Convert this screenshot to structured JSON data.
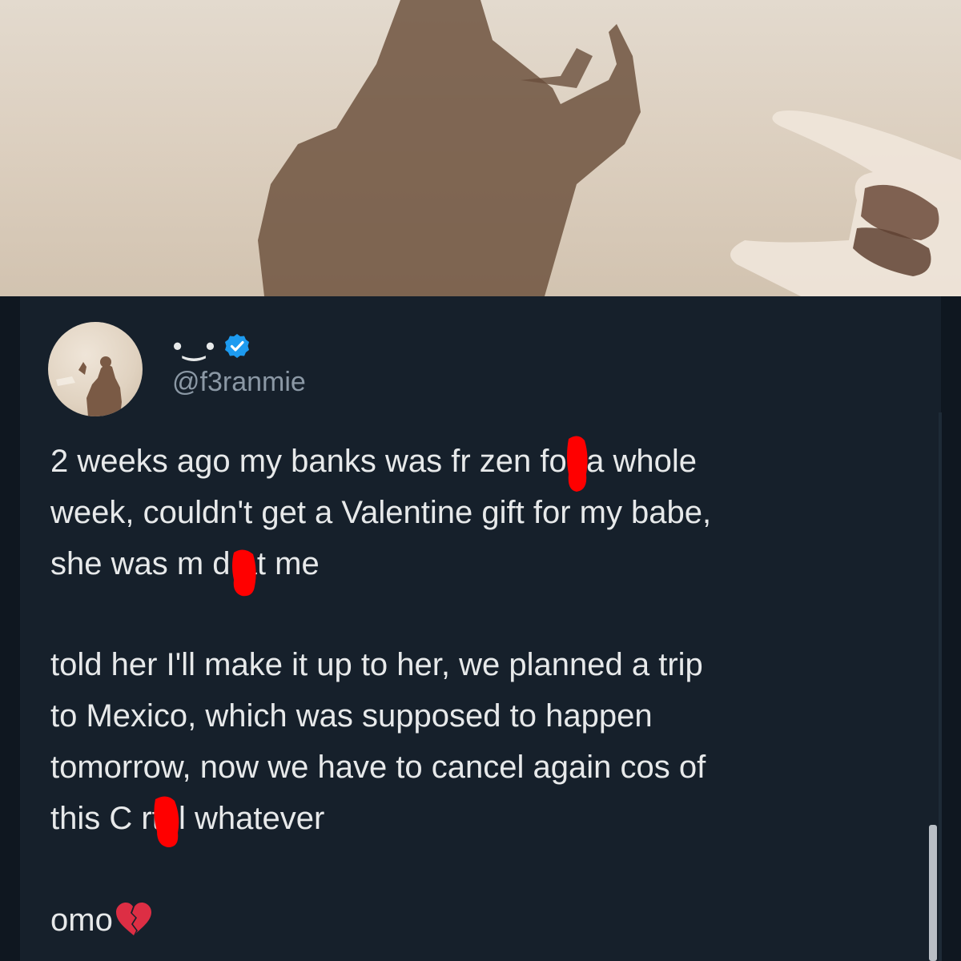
{
  "tweet": {
    "display_name": "•‿•",
    "handle": "@f3ranmie",
    "paragraphs": [
      "2 weeks ago my banks was fr zen for a whole\nweek, couldn't get a Valentine gift for my babe,\nshe was m d at me",
      "told her I'll make it up to her, we planned a trip\nto Mexico, which was supposed to happen\ntomorrow, now we have to cancel again cos of\nthis C rtel whatever",
      "omo"
    ]
  },
  "icons": {
    "verified": "verified-badge-icon",
    "broken_heart": "broken-heart-icon"
  },
  "colors": {
    "background": "#16202b",
    "text": "#e7e9ea",
    "secondary_text": "#8b98a5",
    "verified": "#1d9bf0",
    "censor_marks": "#ff0000"
  }
}
